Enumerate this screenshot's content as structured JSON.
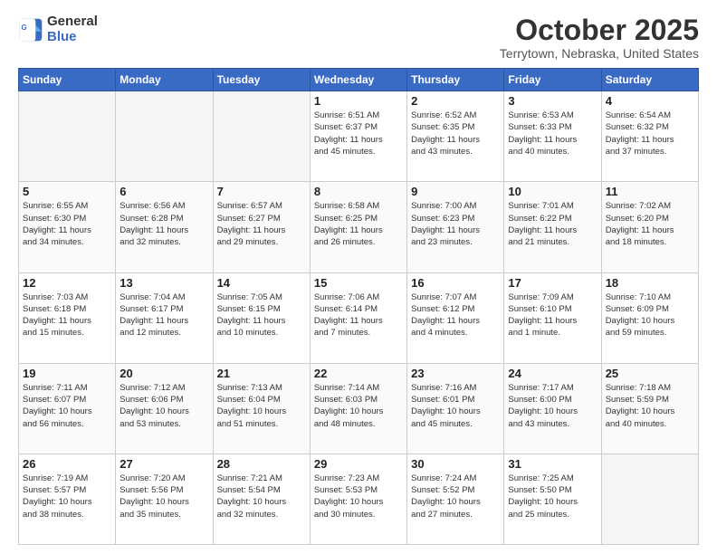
{
  "header": {
    "logo_general": "General",
    "logo_blue": "Blue",
    "month_title": "October 2025",
    "location": "Terrytown, Nebraska, United States"
  },
  "weekdays": [
    "Sunday",
    "Monday",
    "Tuesday",
    "Wednesday",
    "Thursday",
    "Friday",
    "Saturday"
  ],
  "weeks": [
    [
      {
        "day": "",
        "info": ""
      },
      {
        "day": "",
        "info": ""
      },
      {
        "day": "",
        "info": ""
      },
      {
        "day": "1",
        "info": "Sunrise: 6:51 AM\nSunset: 6:37 PM\nDaylight: 11 hours\nand 45 minutes."
      },
      {
        "day": "2",
        "info": "Sunrise: 6:52 AM\nSunset: 6:35 PM\nDaylight: 11 hours\nand 43 minutes."
      },
      {
        "day": "3",
        "info": "Sunrise: 6:53 AM\nSunset: 6:33 PM\nDaylight: 11 hours\nand 40 minutes."
      },
      {
        "day": "4",
        "info": "Sunrise: 6:54 AM\nSunset: 6:32 PM\nDaylight: 11 hours\nand 37 minutes."
      }
    ],
    [
      {
        "day": "5",
        "info": "Sunrise: 6:55 AM\nSunset: 6:30 PM\nDaylight: 11 hours\nand 34 minutes."
      },
      {
        "day": "6",
        "info": "Sunrise: 6:56 AM\nSunset: 6:28 PM\nDaylight: 11 hours\nand 32 minutes."
      },
      {
        "day": "7",
        "info": "Sunrise: 6:57 AM\nSunset: 6:27 PM\nDaylight: 11 hours\nand 29 minutes."
      },
      {
        "day": "8",
        "info": "Sunrise: 6:58 AM\nSunset: 6:25 PM\nDaylight: 11 hours\nand 26 minutes."
      },
      {
        "day": "9",
        "info": "Sunrise: 7:00 AM\nSunset: 6:23 PM\nDaylight: 11 hours\nand 23 minutes."
      },
      {
        "day": "10",
        "info": "Sunrise: 7:01 AM\nSunset: 6:22 PM\nDaylight: 11 hours\nand 21 minutes."
      },
      {
        "day": "11",
        "info": "Sunrise: 7:02 AM\nSunset: 6:20 PM\nDaylight: 11 hours\nand 18 minutes."
      }
    ],
    [
      {
        "day": "12",
        "info": "Sunrise: 7:03 AM\nSunset: 6:18 PM\nDaylight: 11 hours\nand 15 minutes."
      },
      {
        "day": "13",
        "info": "Sunrise: 7:04 AM\nSunset: 6:17 PM\nDaylight: 11 hours\nand 12 minutes."
      },
      {
        "day": "14",
        "info": "Sunrise: 7:05 AM\nSunset: 6:15 PM\nDaylight: 11 hours\nand 10 minutes."
      },
      {
        "day": "15",
        "info": "Sunrise: 7:06 AM\nSunset: 6:14 PM\nDaylight: 11 hours\nand 7 minutes."
      },
      {
        "day": "16",
        "info": "Sunrise: 7:07 AM\nSunset: 6:12 PM\nDaylight: 11 hours\nand 4 minutes."
      },
      {
        "day": "17",
        "info": "Sunrise: 7:09 AM\nSunset: 6:10 PM\nDaylight: 11 hours\nand 1 minute."
      },
      {
        "day": "18",
        "info": "Sunrise: 7:10 AM\nSunset: 6:09 PM\nDaylight: 10 hours\nand 59 minutes."
      }
    ],
    [
      {
        "day": "19",
        "info": "Sunrise: 7:11 AM\nSunset: 6:07 PM\nDaylight: 10 hours\nand 56 minutes."
      },
      {
        "day": "20",
        "info": "Sunrise: 7:12 AM\nSunset: 6:06 PM\nDaylight: 10 hours\nand 53 minutes."
      },
      {
        "day": "21",
        "info": "Sunrise: 7:13 AM\nSunset: 6:04 PM\nDaylight: 10 hours\nand 51 minutes."
      },
      {
        "day": "22",
        "info": "Sunrise: 7:14 AM\nSunset: 6:03 PM\nDaylight: 10 hours\nand 48 minutes."
      },
      {
        "day": "23",
        "info": "Sunrise: 7:16 AM\nSunset: 6:01 PM\nDaylight: 10 hours\nand 45 minutes."
      },
      {
        "day": "24",
        "info": "Sunrise: 7:17 AM\nSunset: 6:00 PM\nDaylight: 10 hours\nand 43 minutes."
      },
      {
        "day": "25",
        "info": "Sunrise: 7:18 AM\nSunset: 5:59 PM\nDaylight: 10 hours\nand 40 minutes."
      }
    ],
    [
      {
        "day": "26",
        "info": "Sunrise: 7:19 AM\nSunset: 5:57 PM\nDaylight: 10 hours\nand 38 minutes."
      },
      {
        "day": "27",
        "info": "Sunrise: 7:20 AM\nSunset: 5:56 PM\nDaylight: 10 hours\nand 35 minutes."
      },
      {
        "day": "28",
        "info": "Sunrise: 7:21 AM\nSunset: 5:54 PM\nDaylight: 10 hours\nand 32 minutes."
      },
      {
        "day": "29",
        "info": "Sunrise: 7:23 AM\nSunset: 5:53 PM\nDaylight: 10 hours\nand 30 minutes."
      },
      {
        "day": "30",
        "info": "Sunrise: 7:24 AM\nSunset: 5:52 PM\nDaylight: 10 hours\nand 27 minutes."
      },
      {
        "day": "31",
        "info": "Sunrise: 7:25 AM\nSunset: 5:50 PM\nDaylight: 10 hours\nand 25 minutes."
      },
      {
        "day": "",
        "info": ""
      }
    ]
  ]
}
